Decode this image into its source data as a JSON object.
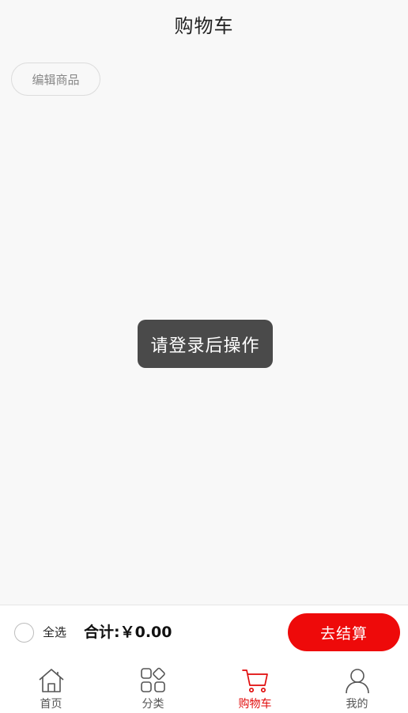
{
  "header": {
    "title": "购物车"
  },
  "edit_button": {
    "label": "编辑商品"
  },
  "toast": {
    "message": "请登录后操作"
  },
  "checkout": {
    "select_all_label": "全选",
    "total_label": "合计:",
    "total_value": "￥0.00",
    "checkout_label": "去结算"
  },
  "tabbar": {
    "items": [
      {
        "label": "首页",
        "icon": "home-icon"
      },
      {
        "label": "分类",
        "icon": "category-icon"
      },
      {
        "label": "购物车",
        "icon": "cart-icon",
        "active": true
      },
      {
        "label": "我的",
        "icon": "user-icon"
      }
    ]
  },
  "colors": {
    "accent": "#ee0a0a",
    "active_tab": "#e10a0a",
    "background": "#f8f8f8",
    "toast_bg": "#4a4a4a"
  }
}
